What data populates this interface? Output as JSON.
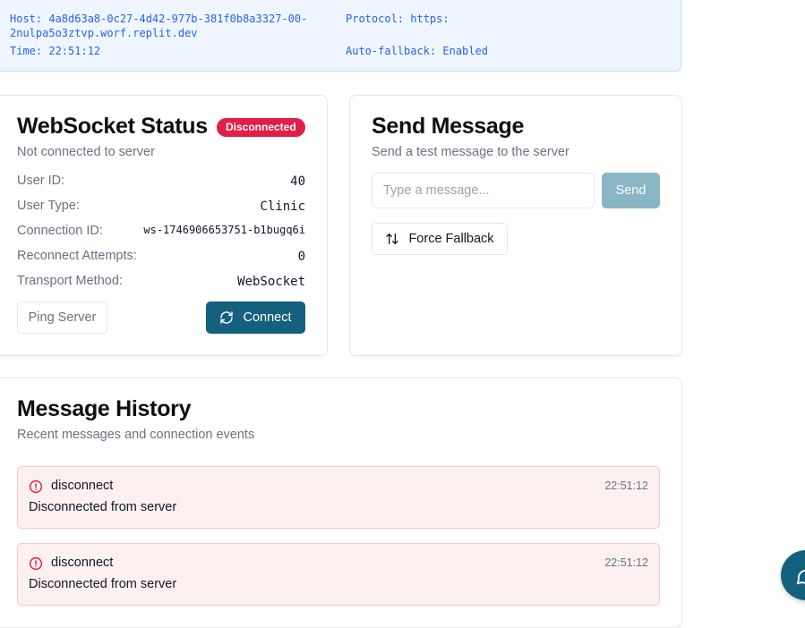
{
  "info": {
    "host": "Host: 4a8d63a8-0c27-4d42-977b-381f0b8a3327-00-",
    "host_cont": "2nulpa5o3ztvp.worf.replit.dev",
    "time": "Time: 22:51:12",
    "protocol": "Protocol: https:",
    "auto_fallback": "Auto-fallback: Enabled"
  },
  "status_card": {
    "title": "WebSocket Status",
    "badge": "Disconnected",
    "subtitle": "Not connected to server",
    "rows": [
      {
        "label": "User ID:",
        "value": "40"
      },
      {
        "label": "User Type:",
        "value": "Clinic"
      },
      {
        "label": "Connection ID:",
        "value": "ws-1746906653751-b1bugq6i"
      },
      {
        "label": "Reconnect Attempts:",
        "value": "0"
      },
      {
        "label": "Transport Method:",
        "value": "WebSocket"
      }
    ],
    "ping_label": "Ping Server",
    "connect_label": "Connect"
  },
  "send_card": {
    "title": "Send Message",
    "subtitle": "Send a test message to the server",
    "input_placeholder": "Type a message...",
    "send_label": "Send",
    "fallback_label": "Force Fallback"
  },
  "history": {
    "title": "Message History",
    "subtitle": "Recent messages and connection events",
    "events": [
      {
        "type": "disconnect",
        "time": "22:51:12",
        "message": "Disconnected from server"
      },
      {
        "type": "disconnect",
        "time": "22:51:12",
        "message": "Disconnected from server"
      }
    ]
  },
  "colors": {
    "primary": "#14617d",
    "badge_red": "#e11d48",
    "event_bg": "#fdf0f1",
    "info_bg": "#eff6ff"
  },
  "icons": {
    "connect": "refresh-icon",
    "fallback": "swap-vertical-icon",
    "event": "alert-circle-icon",
    "fab": "chat-bubble-icon"
  }
}
